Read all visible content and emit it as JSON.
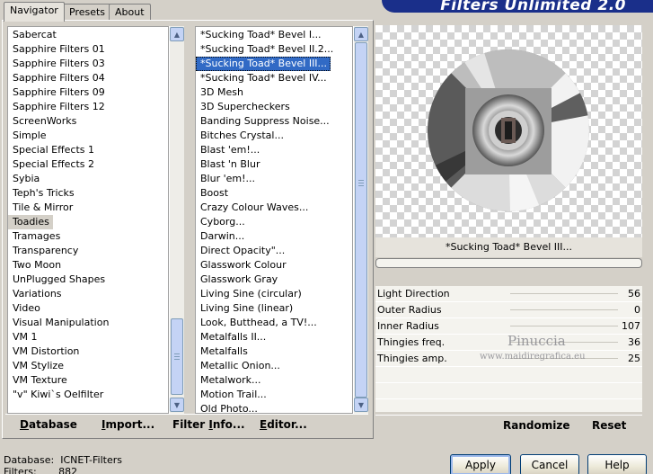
{
  "banner": {
    "title": "Filters Unlimited 2.0"
  },
  "tabs": [
    {
      "label": "Navigator",
      "active": true
    },
    {
      "label": "Presets",
      "active": false
    },
    {
      "label": "About",
      "active": false
    }
  ],
  "categories": [
    "Sabercat",
    "Sapphire Filters 01",
    "Sapphire Filters 03",
    "Sapphire Filters 04",
    "Sapphire Filters 09",
    "Sapphire Filters 12",
    "ScreenWorks",
    "Simple",
    "Special Effects 1",
    "Special Effects 2",
    "Sybia",
    "Teph's Tricks",
    "Tile & Mirror",
    "Toadies",
    "Tramages",
    "Transparency",
    "Two Moon",
    "UnPlugged Shapes",
    "Variations",
    "Video",
    "Visual Manipulation",
    "VM 1",
    "VM Distortion",
    "VM Stylize",
    "VM Texture",
    "\"v\" Kiwi`s Oelfilter"
  ],
  "selected_category": "Toadies",
  "filters": [
    "*Sucking Toad*  Bevel I...",
    "*Sucking Toad*  Bevel II.2...",
    "*Sucking Toad*  Bevel III...",
    "*Sucking Toad*  Bevel IV...",
    "3D Mesh",
    "3D Supercheckers",
    "Banding Suppress Noise...",
    "Bitches Crystal...",
    "Blast 'em!...",
    "Blast 'n Blur",
    "Blur 'em!...",
    "Boost",
    "Crazy Colour Waves...",
    "Cyborg...",
    "Darwin...",
    "Direct Opacity\"...",
    "Glasswork Colour",
    "Glasswork Gray",
    "Living Sine (circular)",
    "Living Sine (linear)",
    "Look, Butthead, a TV!...",
    "Metalfalls II...",
    "Metalfalls",
    "Metallic Onion...",
    "Metalwork...",
    "Motion Trail...",
    "Old Photo..."
  ],
  "selected_filter": "*Sucking Toad*  Bevel III...",
  "nav_links": {
    "database": "Database",
    "import": "Import...",
    "filter_info": "Filter Info...",
    "editor": "Editor..."
  },
  "preview": {
    "filter_name": "*Sucking Toad*  Bevel III..."
  },
  "params": [
    {
      "label": "Light Direction",
      "value": "56"
    },
    {
      "label": "Outer Radius",
      "value": "0"
    },
    {
      "label": "Inner Radius",
      "value": "107"
    },
    {
      "label": "Thingies freq.",
      "value": "36"
    },
    {
      "label": "Thingies amp.",
      "value": "25"
    }
  ],
  "watermark": {
    "name": "Pinuccia",
    "site": "www.maidiregrafica.eu"
  },
  "actions": {
    "randomize": "Randomize",
    "reset": "Reset"
  },
  "status": {
    "database_label": "Database:",
    "database_value": "ICNET-Filters",
    "filters_label": "Filters:",
    "filters_value": "882"
  },
  "buttons": {
    "apply": "Apply",
    "cancel": "Cancel",
    "help": "Help"
  }
}
